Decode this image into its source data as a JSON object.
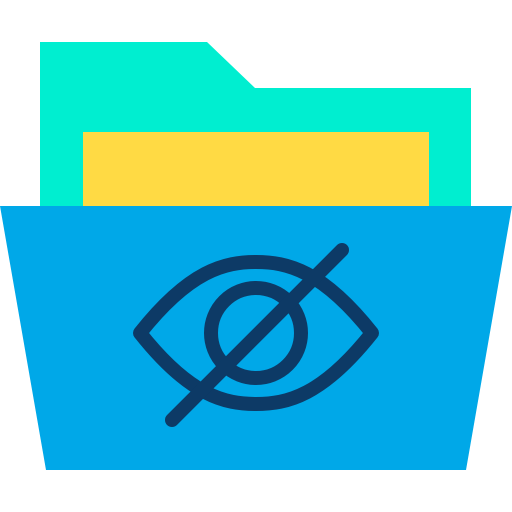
{
  "icon": {
    "name": "hidden-folder-icon",
    "parts": [
      "folder-back",
      "paper-sheet",
      "folder-front",
      "eye-slash"
    ]
  },
  "colors": {
    "background": "#ffffff",
    "folder_back": "#00EED0",
    "paper": "#FFDA44",
    "folder_front": "#00A8E8",
    "eye_stroke": "#0D3A66"
  }
}
